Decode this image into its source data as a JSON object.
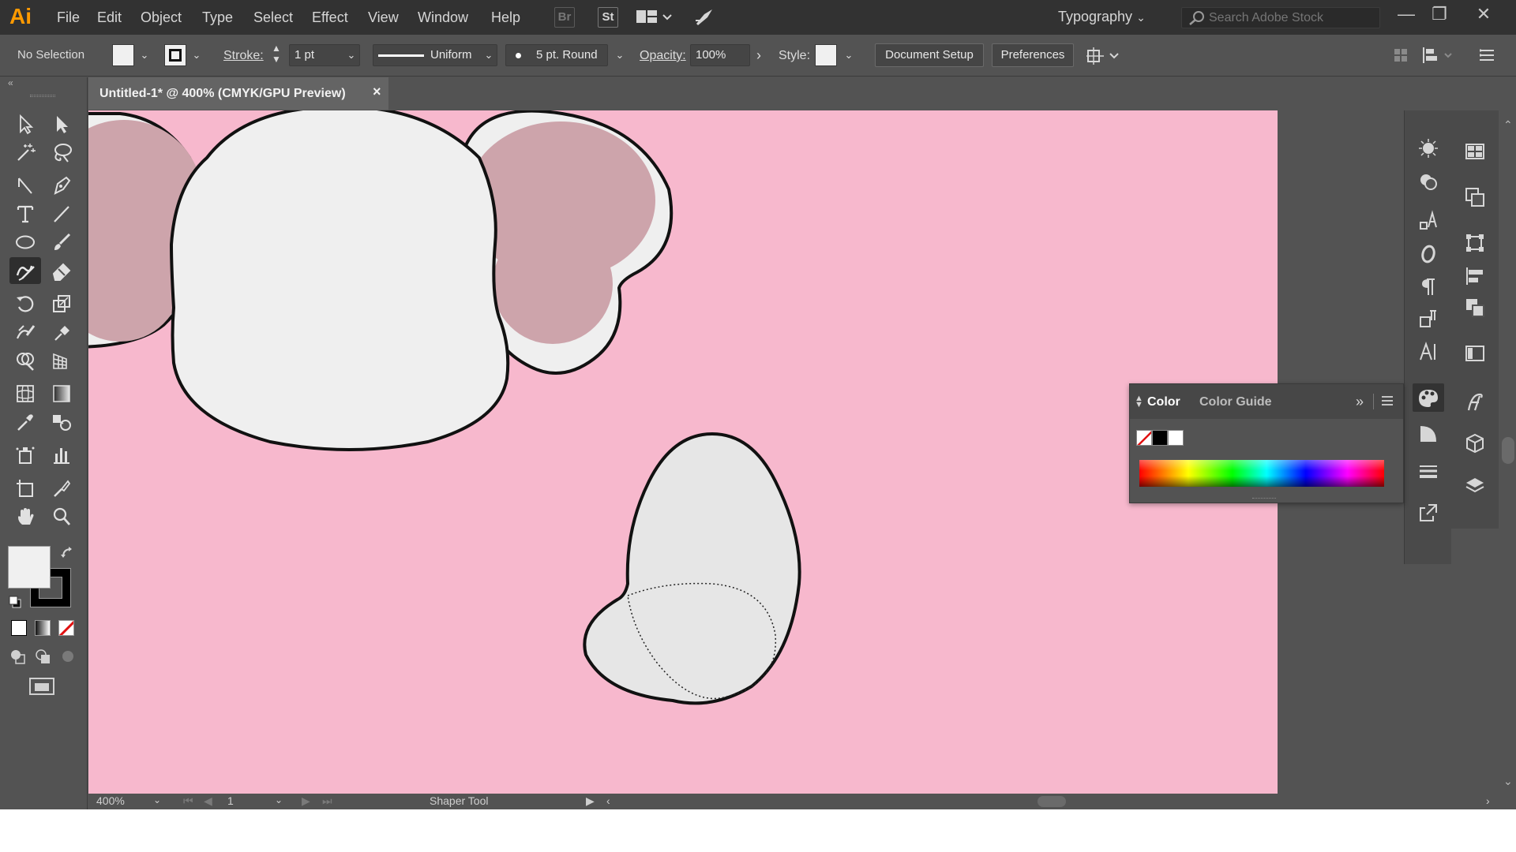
{
  "app": {
    "logo": "Ai",
    "workspace": "Typography",
    "stock_placeholder": "Search Adobe Stock"
  },
  "menu": [
    "File",
    "Edit",
    "Object",
    "Type",
    "Select",
    "Effect",
    "View",
    "Window",
    "Help"
  ],
  "bridge": {
    "br": "Br",
    "st": "St"
  },
  "control": {
    "selection": "No Selection",
    "stroke_label": "Stroke:",
    "stroke_weight": "1 pt",
    "profile": "Uniform",
    "brush": "5 pt. Round",
    "opacity_label": "Opacity:",
    "opacity": "100%",
    "style_label": "Style:",
    "doc_setup": "Document Setup",
    "preferences": "Preferences"
  },
  "document": {
    "tab_title": "Untitled-1* @ 400% (CMYK/GPU Preview)",
    "close": "×"
  },
  "status": {
    "zoom": "400%",
    "artboard": "1",
    "tool": "Shaper Tool"
  },
  "color_panel": {
    "tab_color": "Color",
    "tab_guide": "Color Guide"
  },
  "colors": {
    "canvas": "#f7b8cd",
    "ear_fill": "#cda4ab",
    "shape_fill": "#efefef",
    "egg_fill": "#e6e6e6",
    "accent_logo": "#ff9a00"
  },
  "icons": {
    "tools": [
      "selection",
      "direct-selection",
      "magic-wand",
      "lasso",
      "pen-add-anchor",
      "pen",
      "type",
      "line-segment",
      "ellipse",
      "paintbrush",
      "shaper",
      "eraser",
      "rotate",
      "scale",
      "warp",
      "puppet-pin",
      "shape-builder",
      "perspective-grid",
      "mesh",
      "gradient",
      "eyedropper",
      "blend",
      "symbol-sprayer",
      "column-graph",
      "artboard",
      "slice",
      "hand",
      "zoom"
    ],
    "dock1": [
      "brushes",
      "color-wheel",
      "glyphs",
      "opentype",
      "paragraph",
      "paragraph-styles",
      "character",
      "color",
      "gradient",
      "stroke",
      "export"
    ],
    "dock2": [
      "swatches",
      "pathfinder",
      "transform",
      "align",
      "arrange",
      "transparency",
      "character-styles",
      "3d",
      "layers"
    ]
  }
}
